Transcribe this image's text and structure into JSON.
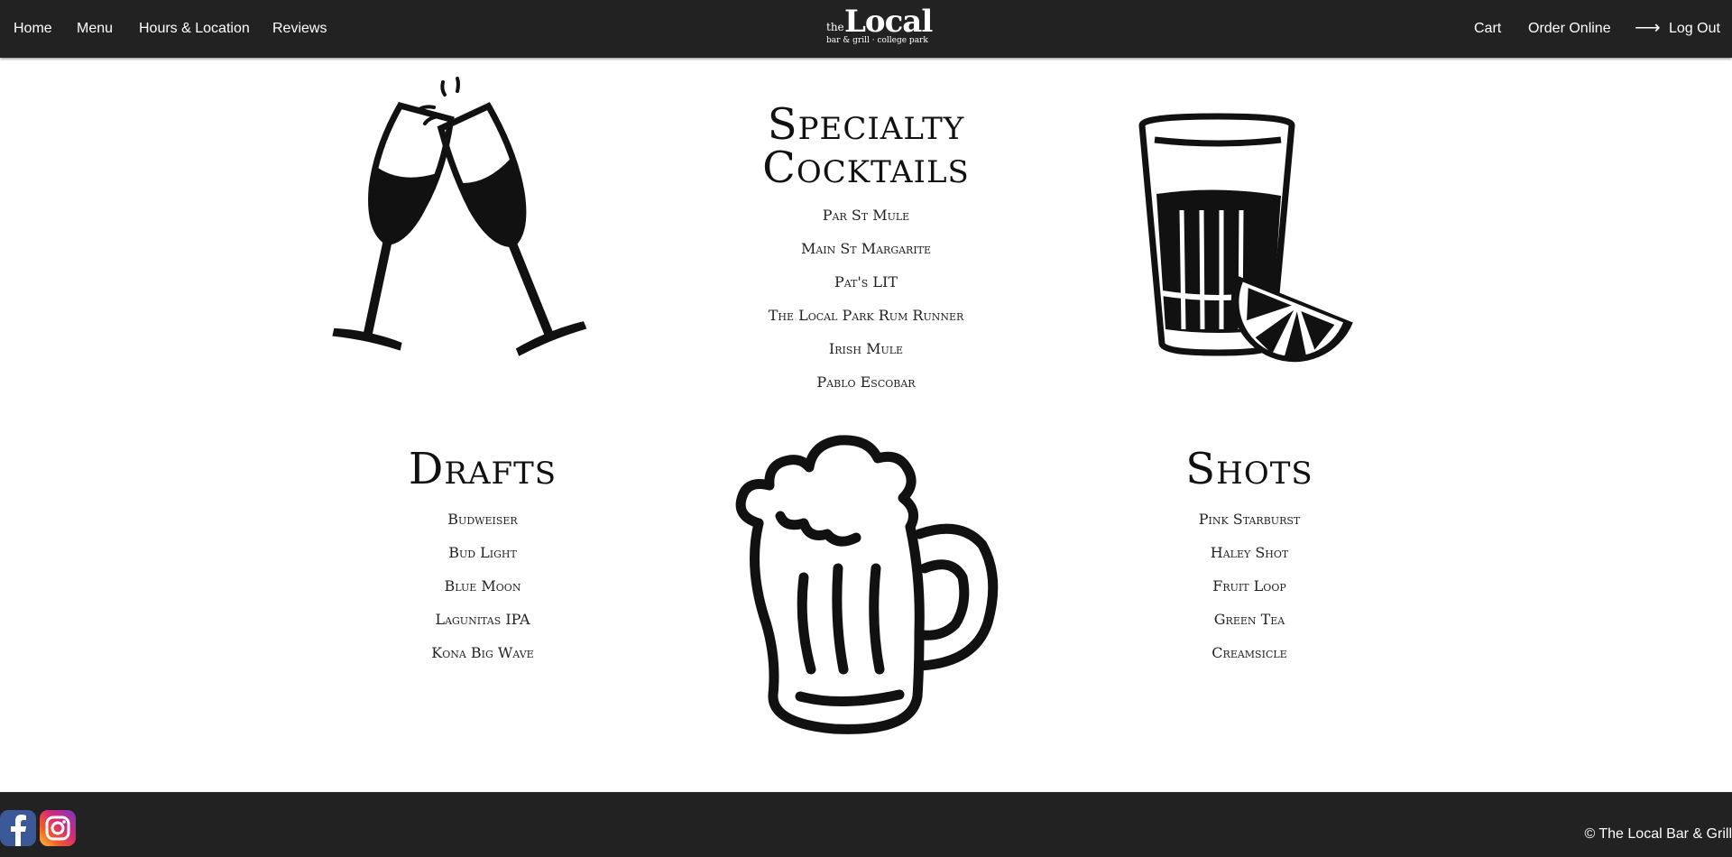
{
  "nav": {
    "left": [
      {
        "label": "Home"
      },
      {
        "label": "Menu"
      },
      {
        "label": "Hours & Location"
      },
      {
        "label": "Reviews"
      }
    ],
    "logo": {
      "the": "the",
      "name": "Local",
      "tagline": "bar & grill · college park"
    },
    "right": {
      "cart": "Cart",
      "order": "Order Online",
      "logout": "Log Out",
      "logout_icon": "arrow-right-icon"
    }
  },
  "sections": {
    "cocktails": {
      "title_line1": "Specialty",
      "title_line2": "Cocktails",
      "items": [
        "Par St Mule",
        "Main St Margarite",
        "Pat's LIT",
        "The Local Park Rum Runner",
        "Irish Mule",
        "Pablo Escobar"
      ]
    },
    "drafts": {
      "title": "Drafts",
      "items": [
        "Budweiser",
        "Bud Light",
        "Blue Moon",
        "Lagunitas IPA",
        "Kona Big Wave"
      ]
    },
    "shots": {
      "title": "Shots",
      "items": [
        "Pink Starburst",
        "Haley Shot",
        "Fruit Loop",
        "Green Tea",
        "Creamsicle"
      ]
    }
  },
  "illustrations": [
    "champagne-toast-icon",
    "shot-glass-lime-icon",
    "beer-mug-icon"
  ],
  "footer": {
    "social": [
      {
        "name": "facebook-icon",
        "color": "#3b5998"
      },
      {
        "name": "instagram-icon",
        "color": "#d6297b"
      }
    ],
    "copyright": "© The Local Bar & Grill"
  },
  "colors": {
    "nav_bg": "#222222",
    "footer_bg": "#222222",
    "text": "#111111",
    "nav_text": "#ffffff"
  }
}
